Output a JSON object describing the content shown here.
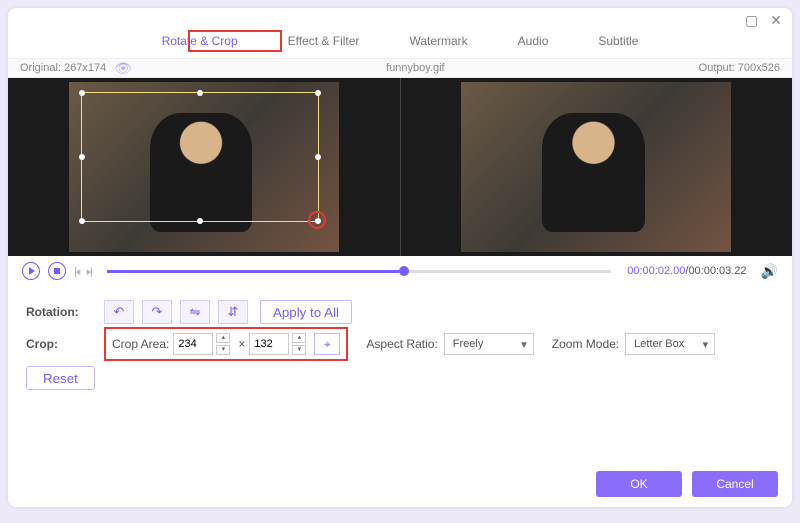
{
  "titlebar": {
    "max": "▢",
    "close": "✕"
  },
  "tabs": {
    "rotate_crop": "Rotate & Crop",
    "effect_filter": "Effect & Filter",
    "watermark": "Watermark",
    "audio": "Audio",
    "subtitle": "Subtitle"
  },
  "info": {
    "original_label": "Original: 267x174",
    "filename": "funnyboy.gif",
    "output_label": "Output: 700x526"
  },
  "playbar": {
    "current_time": "00:00:02.00",
    "total_time": "00:00:03.22",
    "sep": "/"
  },
  "rotation": {
    "label": "Rotation:",
    "apply_all": "Apply to All"
  },
  "crop": {
    "label": "Crop:",
    "area_label": "Crop Area:",
    "width": "234",
    "height": "132",
    "x_sep": "×",
    "aspect_label": "Aspect Ratio:",
    "aspect_value": "Freely",
    "zoom_label": "Zoom Mode:",
    "zoom_value": "Letter Box"
  },
  "reset": "Reset",
  "footer": {
    "ok": "OK",
    "cancel": "Cancel"
  }
}
